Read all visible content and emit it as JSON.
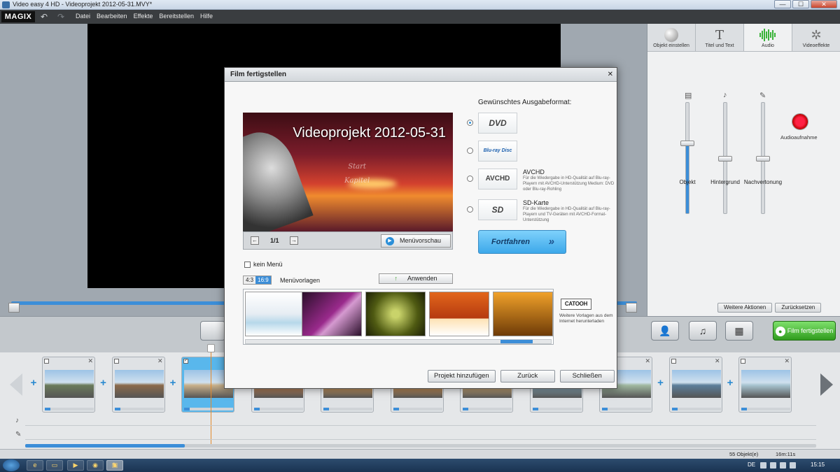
{
  "window": {
    "title": "Video easy 4 HD - Videoprojekt 2012-05-31.MVY*",
    "minimize": "—",
    "maximize": "☐",
    "close": "✕"
  },
  "menubar": {
    "logo": "MAGIX",
    "undo": "↶",
    "redo": "↷",
    "items": [
      "Datei",
      "Bearbeiten",
      "Effekte",
      "Bereitstellen",
      "Hilfe"
    ]
  },
  "right_panel": {
    "tabs": [
      {
        "label": "Objekt einstellen",
        "icon": "circle-icon"
      },
      {
        "label": "Titel und Text",
        "icon": "T"
      },
      {
        "label": "Audio",
        "icon": "audio-wave-icon"
      },
      {
        "label": "Videoeffekte",
        "icon": "stars-icon"
      }
    ],
    "sliders": [
      {
        "label": "Objekt",
        "value": 0.64
      },
      {
        "label": "Hintergrund",
        "value": 0.5
      },
      {
        "label": "Nachvertonung",
        "value": 0.5
      }
    ],
    "record_label": "Audioaufnahme",
    "more_actions": "Weitere Aktionen",
    "reset": "Zurücksetzen"
  },
  "toolbar": {
    "finish_label": "Film fertigstellen"
  },
  "timeline": {
    "clip_count": 11,
    "selected_clip": 3
  },
  "status": {
    "objects": "55 Objekt(e)",
    "duration": "16m:11s"
  },
  "taskbar": {
    "lang": "DE",
    "clock": "15:15"
  },
  "dialog": {
    "title": "Film fertigstellen",
    "close": "✕",
    "preview": {
      "title": "Videoprojekt 2012-05-31",
      "menu_items": [
        "Start",
        "Kapitel"
      ],
      "page": "1/1",
      "menu_preview": "Menüvorschau"
    },
    "format_heading": "Gewünschtes Ausgabeformat:",
    "formats": [
      {
        "logo": "DVD",
        "name": "",
        "desc": "",
        "selected": true
      },
      {
        "logo": "Blu-ray Disc",
        "name": "",
        "desc": "",
        "selected": false
      },
      {
        "logo": "AVCHD",
        "name": "AVCHD",
        "desc": "Für die Wiedergabe in HD-Qualität auf Blu-ray-Playern mit AVCHD-Unterstützung Medium: DVD oder Blu-ray-Rohling",
        "selected": false
      },
      {
        "logo": "SD",
        "name": "SD-Karte",
        "desc": "Für die Wiedergabe in HD-Qualität auf Blu-ray-Playern und TV-Geräten mit AVCHD-Format-Unterstützung",
        "selected": false
      }
    ],
    "continue": "Fortfahren",
    "no_menu": "kein Menü",
    "ratio_43": "4:3",
    "ratio_169": "16:9",
    "menu_templates": "Menüvorlagen",
    "apply": "Anwenden",
    "catooh_logo": "CATOOH",
    "catooh_text": "Weitere Vorlagen aus dem Internet herunterladen",
    "buttons": {
      "add_project": "Projekt hinzufügen",
      "back": "Zurück",
      "close": "Schließen"
    }
  }
}
